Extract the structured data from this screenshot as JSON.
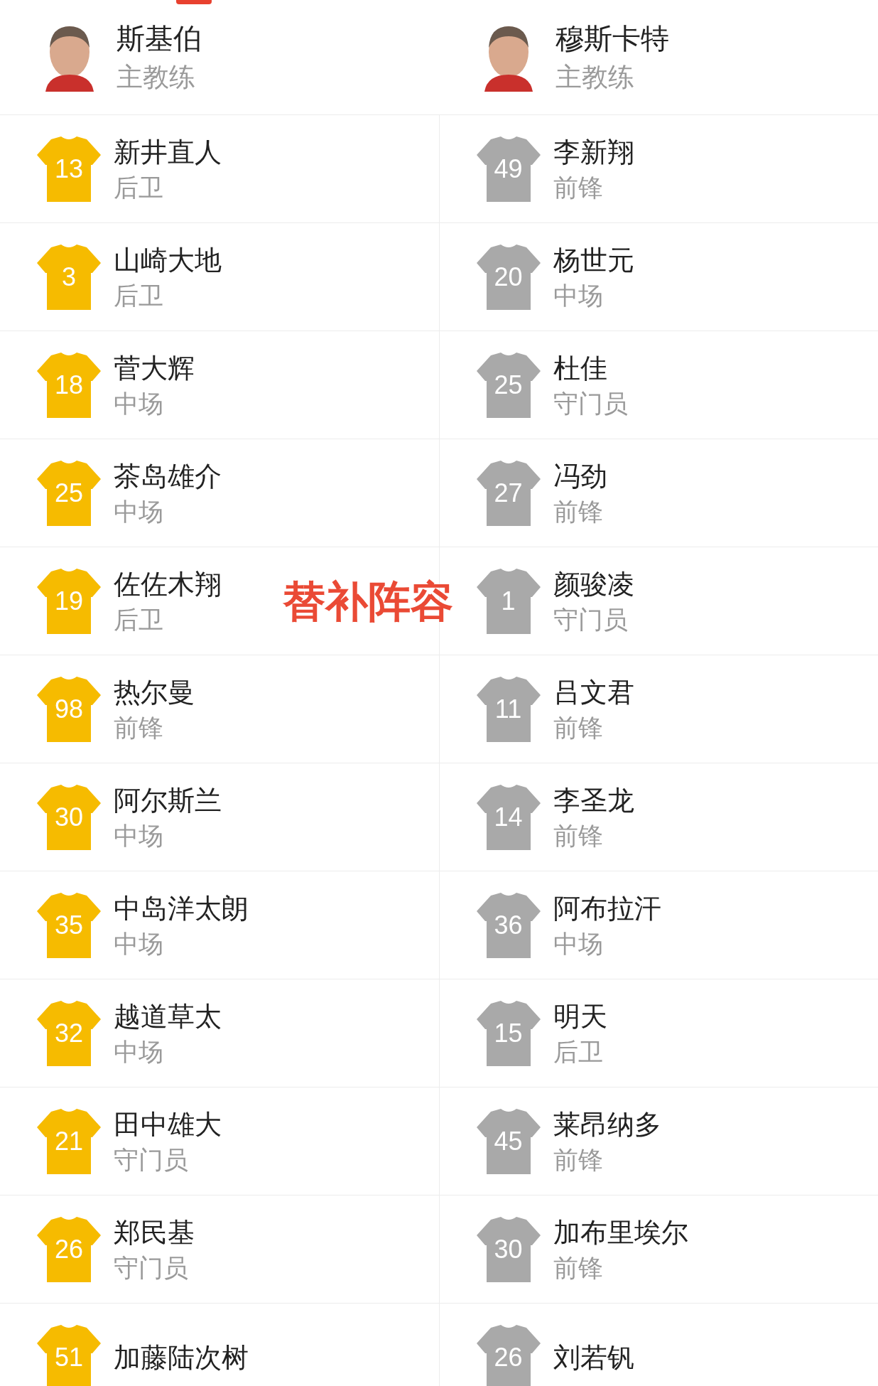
{
  "teams": [
    {
      "coach": "斯基伯",
      "coach_role": "主教练",
      "color": "#f6bb00",
      "players": [
        {
          "number": "13",
          "name": "新井直人",
          "position": "后卫"
        },
        {
          "number": "3",
          "name": "山崎大地",
          "position": "后卫"
        },
        {
          "number": "18",
          "name": "菅大辉",
          "position": "中场"
        },
        {
          "number": "25",
          "name": "茶岛雄介",
          "position": "中场"
        },
        {
          "number": "19",
          "name": "佐佐木翔",
          "position": "后卫"
        },
        {
          "number": "98",
          "name": "热尔曼",
          "position": "前锋"
        },
        {
          "number": "30",
          "name": "阿尔斯兰",
          "position": "中场"
        },
        {
          "number": "35",
          "name": "中岛洋太朗",
          "position": "中场"
        },
        {
          "number": "32",
          "name": "越道草太",
          "position": "中场"
        },
        {
          "number": "21",
          "name": "田中雄大",
          "position": "守门员"
        },
        {
          "number": "26",
          "name": "郑民基",
          "position": "守门员"
        },
        {
          "number": "51",
          "name": "加藤陆次树"
        }
      ]
    },
    {
      "coach": "穆斯卡特",
      "coach_role": "主教练",
      "color": "#a9a9a9",
      "players": [
        {
          "number": "49",
          "name": "李新翔",
          "position": "前锋"
        },
        {
          "number": "20",
          "name": "杨世元",
          "position": "中场"
        },
        {
          "number": "25",
          "name": "杜佳",
          "position": "守门员"
        },
        {
          "number": "27",
          "name": "冯劲",
          "position": "前锋"
        },
        {
          "number": "1",
          "name": "颜骏凌",
          "position": "守门员"
        },
        {
          "number": "11",
          "name": "吕文君",
          "position": "前锋"
        },
        {
          "number": "14",
          "name": "李圣龙",
          "position": "前锋"
        },
        {
          "number": "36",
          "name": "阿布拉汗",
          "position": "中场"
        },
        {
          "number": "15",
          "name": "明天",
          "position": "后卫"
        },
        {
          "number": "45",
          "name": "莱昂纳多",
          "position": "前锋"
        },
        {
          "number": "30",
          "name": "加布里埃尔",
          "position": "前锋"
        },
        {
          "number": "26",
          "name": "刘若钒"
        }
      ]
    }
  ],
  "overlay_label": "替补阵容"
}
